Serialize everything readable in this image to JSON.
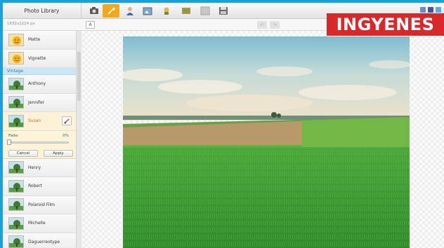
{
  "header": {
    "library_tab": "Photo Library",
    "tools": [
      {
        "name": "camera-icon"
      },
      {
        "name": "magic-wand-icon",
        "active": true
      },
      {
        "name": "person-icon"
      },
      {
        "name": "frame-icon"
      },
      {
        "name": "sticker-icon"
      },
      {
        "name": "picture-icon"
      },
      {
        "name": "texture-icon"
      },
      {
        "name": "save-icon"
      }
    ]
  },
  "toolbar": {
    "image_size": "1632x1224 px",
    "compare_label": "A",
    "undo_icon": "undo-icon",
    "redo_icon": "redo-icon"
  },
  "sidebar": {
    "items_top": [
      {
        "label": "Matte"
      },
      {
        "label": "Vignette"
      }
    ],
    "group_header": "Vintage",
    "items_mid": [
      {
        "label": "Anthony"
      },
      {
        "label": "Jennifer"
      }
    ],
    "active_item": {
      "label": "Susan"
    },
    "fade": {
      "label": "Fade:",
      "value": "0%",
      "level": 0,
      "cancel": "Cancel",
      "apply": "Apply"
    },
    "items_bottom": [
      {
        "label": "Henry"
      },
      {
        "label": "Robert"
      },
      {
        "label": "Polaroid Film"
      },
      {
        "label": "Michelle"
      },
      {
        "label": "Daguerreotype"
      }
    ]
  },
  "overlay": {
    "badge_text": "INGYENES"
  },
  "colors": {
    "frame_blue": "#1f9fd8",
    "accent_orange": "#f0a91c",
    "group_blue": "#cbe6f7",
    "badge_red": "#d8282a"
  }
}
